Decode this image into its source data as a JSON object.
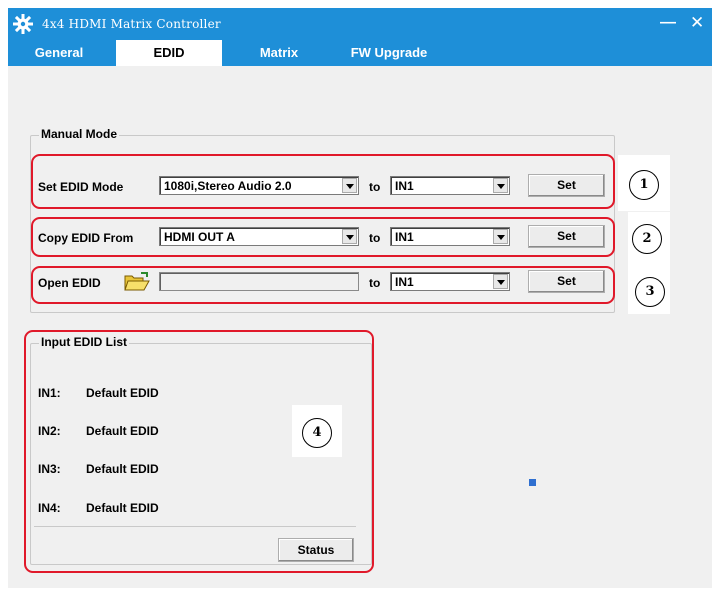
{
  "window": {
    "title": "4x4 HDMI Matrix Controller",
    "icon": "gear-icon",
    "minimize_icon": "minimize-icon",
    "close_icon": "close-icon"
  },
  "tabs": [
    {
      "label": "General"
    },
    {
      "label": "EDID"
    },
    {
      "label": "Matrix"
    },
    {
      "label": "FW Upgrade"
    }
  ],
  "active_tab": "EDID",
  "manual_mode": {
    "title": "Manual Mode",
    "set_edid_mode": {
      "label": "Set EDID Mode",
      "mode_value": "1080i,Stereo Audio 2.0",
      "to_label": "to",
      "target_value": "IN1",
      "button": "Set"
    },
    "copy_edid": {
      "label": "Copy EDID From",
      "source_value": "HDMI OUT A",
      "to_label": "to",
      "target_value": "IN1",
      "button": "Set"
    },
    "open_edid": {
      "label": "Open EDID",
      "folder_icon": "open-folder-icon",
      "file_value": "",
      "to_label": "to",
      "target_value": "IN1",
      "button": "Set"
    }
  },
  "input_edid_list": {
    "title": "Input EDID List",
    "rows": [
      {
        "input": "IN1:",
        "value": "Default EDID"
      },
      {
        "input": "IN2:",
        "value": "Default EDID"
      },
      {
        "input": "IN3:",
        "value": "Default EDID"
      },
      {
        "input": "IN4:",
        "value": "Default EDID"
      }
    ],
    "status_button": "Status"
  },
  "callouts": [
    "1",
    "2",
    "3",
    "4"
  ],
  "colors": {
    "titlebar": "#1e8fd8",
    "highlight": "#e0192a",
    "client": "#f0f0f0"
  }
}
